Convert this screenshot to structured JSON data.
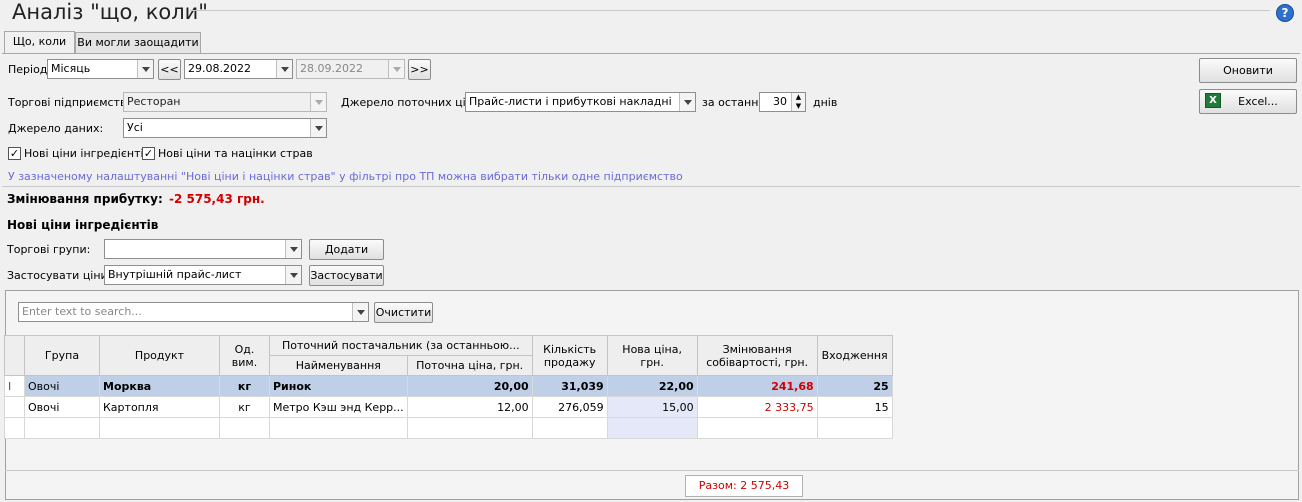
{
  "window": {
    "title": "Аналіз \"що, коли\""
  },
  "tabs": [
    {
      "label": "Що, коли",
      "active": true
    },
    {
      "label": "Ви могли заощадити",
      "active": false
    }
  ],
  "filters": {
    "period_label": "Період",
    "period_value": "Місяць",
    "prev_label": "<<",
    "date_from": "29.08.2022",
    "date_to": "28.09.2022",
    "next_label": ">>",
    "enterprises_label": "Торгові підприємства:",
    "enterprises_value": "Ресторан",
    "price_source_label": "Джерело поточних цін:",
    "price_source_value": "Прайс-листи і прибуткові накладні",
    "last_label": "за останні",
    "last_days": "30",
    "days_label": "днів",
    "data_source_label": "Джерело даних:",
    "data_source_value": "Усі",
    "chk_ingredients_label": "Нові ціни інгредієнтів",
    "chk_ingredients_checked": "✓",
    "chk_dishes_label": "Нові ціни та націнки страв",
    "chk_dishes_checked": "✓",
    "note": "У зазначеному налаштуванні \"Нові ціни і націнки страв\" у фільтрі про ТП можна вибрати тільки одне підприємство"
  },
  "actions": {
    "refresh_label": "Оновити",
    "excel_label": "Excel...",
    "excel_icon": "X"
  },
  "profit": {
    "label": "Змінювання прибутку:",
    "value": "-2 575,43 грн."
  },
  "section": {
    "title": "Нові ціни інгредієнтів",
    "groups_label": "Торгові групи:",
    "groups_value": "",
    "add_label": "Додати",
    "apply_prices_label": "Застосувати ціни:",
    "apply_prices_value": "Внутрішній прайс-лист",
    "apply_label": "Застосувати"
  },
  "search": {
    "placeholder": "Enter text to search...",
    "clear_label": "Очистити"
  },
  "table": {
    "headers": {
      "group": "Група",
      "product": "Продукт",
      "unit": "Од. вим.",
      "supplier": "Поточний постачальник (за останньою...",
      "supplier_name": "Найменування",
      "current_price": "Поточна ціна, грн.",
      "qty": "Кількість продажу",
      "new_price": "Нова ціна, грн.",
      "cost_change": "Змінювання собівартості, грн.",
      "entries": "Входження"
    },
    "rows": [
      {
        "group": "Овочі",
        "product": "Морква",
        "unit": "кг",
        "supplier_name": "Ринок",
        "current_price": "20,00",
        "qty": "31,039",
        "new_price": "22,00",
        "cost_change": "241,68",
        "entries": "25"
      },
      {
        "group": "Овочі",
        "product": "Картопля",
        "unit": "кг",
        "supplier_name": "Метро Кэш энд Керр...",
        "current_price": "12,00",
        "qty": "276,059",
        "new_price": "15,00",
        "cost_change": "2 333,75",
        "entries": "15"
      }
    ],
    "row_marker": "I",
    "total": "Разом: 2 575,43"
  },
  "colors": {
    "accent_red": "#d00000",
    "selection": "#bfcfe8",
    "note_blue": "#6a6ad8"
  }
}
